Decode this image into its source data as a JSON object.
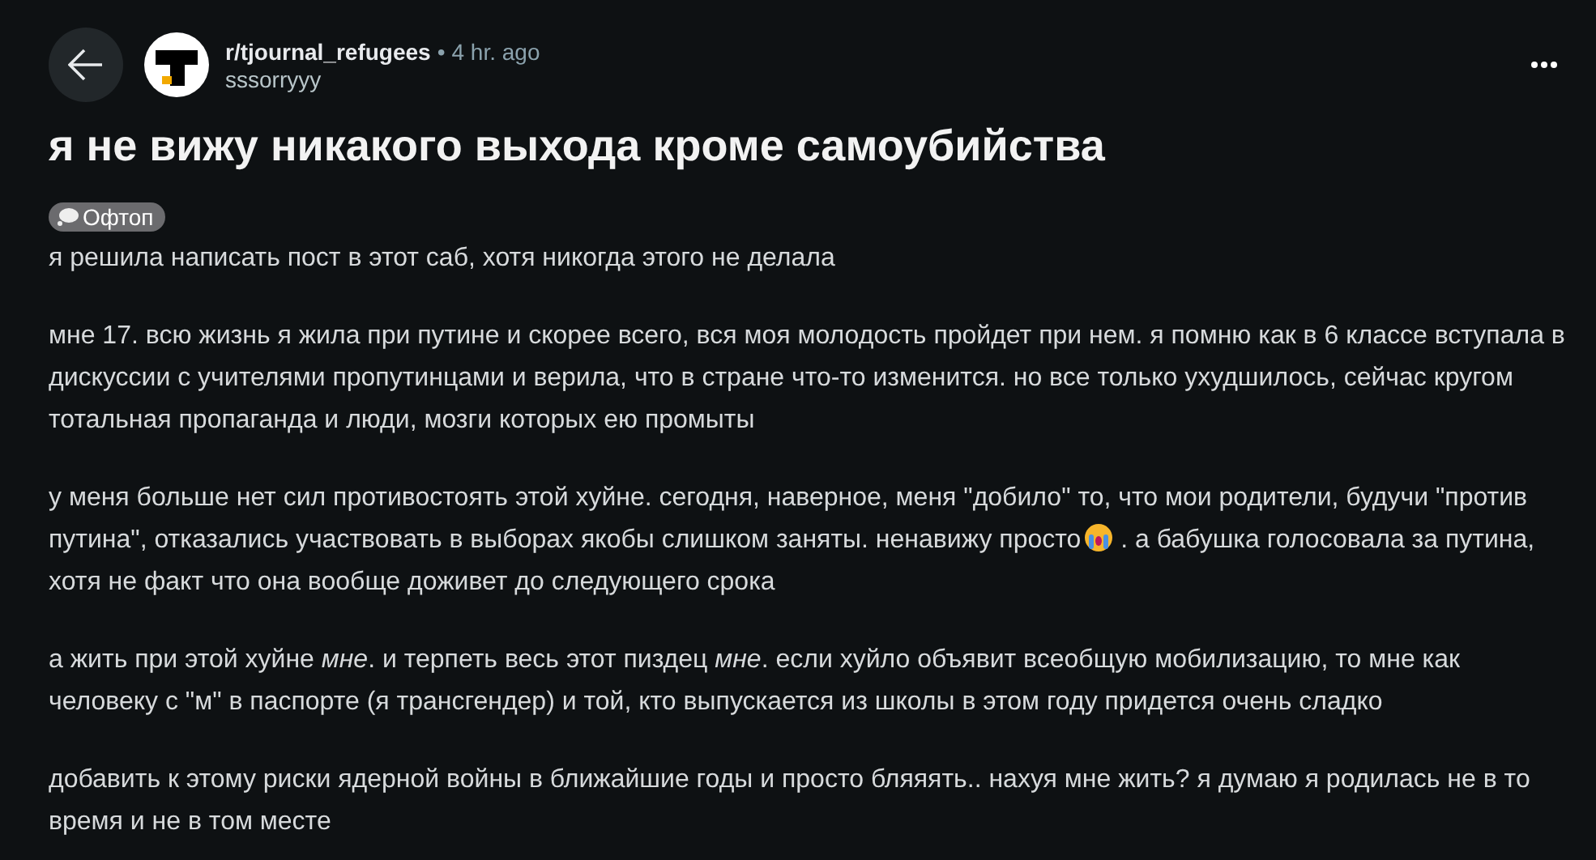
{
  "post": {
    "subreddit": "r/tjournal_refugees",
    "separator": "•",
    "time": "4 hr. ago",
    "author": "sssorryyy",
    "title": "я не вижу никакого выхода кроме самоубийства",
    "flair": "Офтоп",
    "paragraphs": [
      [
        {
          "kind": "text",
          "text": "я решила написать пост в этот саб, хотя никогда этого не делала"
        }
      ],
      [
        {
          "kind": "text",
          "text": "мне 17. всю жизнь я жила при путине и скорее всего, вся моя молодость пройдет при нем. я помню как в 6 классе вступала в дискуссии с учителями пропутинцами и верила, что в стране что-то изменится. но все только ухудшилось, сейчас кругом тотальная пропаганда и люди, мозги которых ею промыты"
        }
      ],
      [
        {
          "kind": "text",
          "text": "у меня больше нет сил противостоять этой хуйне. сегодня, наверное, меня \"добило\" то, что мои родители, будучи \"против путина\", отказались участвовать в выборах якобы слишком заняты. ненавижу просто"
        },
        {
          "kind": "emoji"
        },
        {
          "kind": "text",
          "text": " . а бабушка голосовала за путина, хотя не факт что она вообще доживет до следующего срока"
        }
      ],
      [
        {
          "kind": "text",
          "text": "а жить при этой хуйне *мне*. и терпеть весь этот пиздец *мне*. если хуйло объявит всеобщую мобилизацию, то мне как человеку с \"м\" в паспорте (я трансгендер) и той, кто выпускается из школы в этом году придется очень сладко"
        }
      ],
      [
        {
          "kind": "text",
          "text": "добавить к этому риски ядерной войны в ближайшие годы и просто бляяять.. нахуя мне жить? я думаю я родилась не в то время и не в том месте"
        }
      ]
    ]
  }
}
